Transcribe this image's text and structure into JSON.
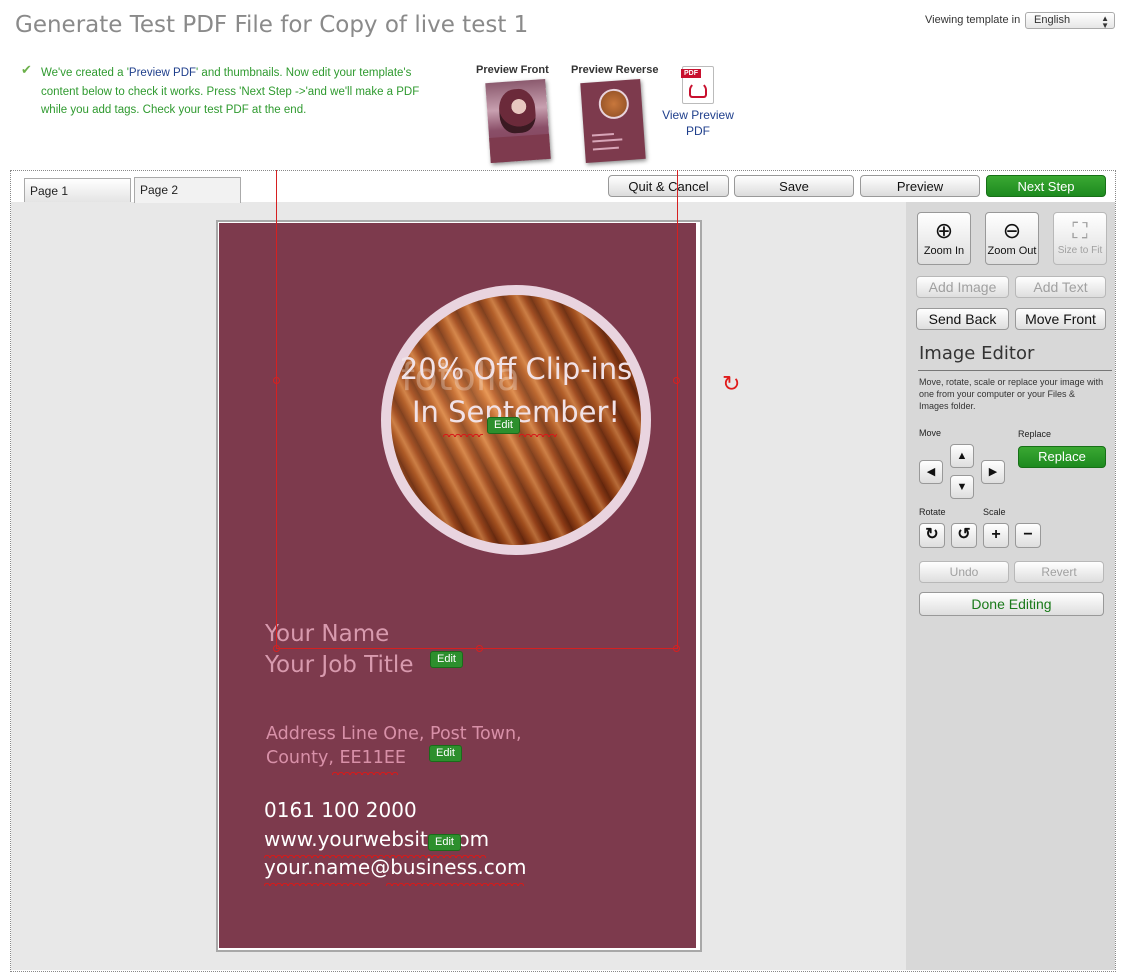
{
  "header": {
    "title": "Generate Test PDF File for Copy of live test 1",
    "viewing_label": "Viewing template in",
    "language": "English"
  },
  "intro": {
    "part1": "We've created a '",
    "link": "Preview PDF",
    "part2": "' and thumbnails. Now edit your template's content below to check it works. Press 'Next Step ->'and we'll make a PDF while you add tags. Check your test PDF at the end."
  },
  "thumbnails": {
    "front_label": "Preview Front",
    "reverse_label": "Preview Reverse",
    "pdf_badge": "PDF",
    "view_link": "View Preview PDF"
  },
  "tabs": [
    {
      "label": "Page 1"
    },
    {
      "label": "Page 2"
    }
  ],
  "toolbar": {
    "quit": "Quit & Cancel",
    "save": "Save",
    "preview": "Preview",
    "next": "Next Step"
  },
  "card": {
    "watermark": "fotolia",
    "promo": "20% Off Clip-ins In September!",
    "name": "Your Name",
    "job_title": "Your Job Title",
    "address_line1": "Address Line One, Post Town,",
    "address_line2": "County, EE11EE",
    "phone": "0161 100 2000",
    "website": "www.yourwebsite.com",
    "email": "your.name@business.com",
    "edit_label": "Edit"
  },
  "panel": {
    "zoom_in": "Zoom In",
    "zoom_out": "Zoom Out",
    "size_to_fit": "Size to Fit",
    "add_image": "Add Image",
    "add_text": "Add Text",
    "send_back": "Send Back",
    "move_front": "Move Front",
    "image_editor_title": "Image Editor",
    "image_editor_desc": "Move, rotate, scale or replace your image with one from your computer or your Files & Images folder.",
    "move_label": "Move",
    "replace_label": "Replace",
    "replace_button": "Replace",
    "rotate_label": "Rotate",
    "scale_label": "Scale",
    "undo": "Undo",
    "revert": "Revert",
    "done_editing": "Done Editing"
  },
  "colors": {
    "card_background": "#7d3a4d",
    "accent_green": "#2d8f2d",
    "selection_red": "#d62020"
  }
}
